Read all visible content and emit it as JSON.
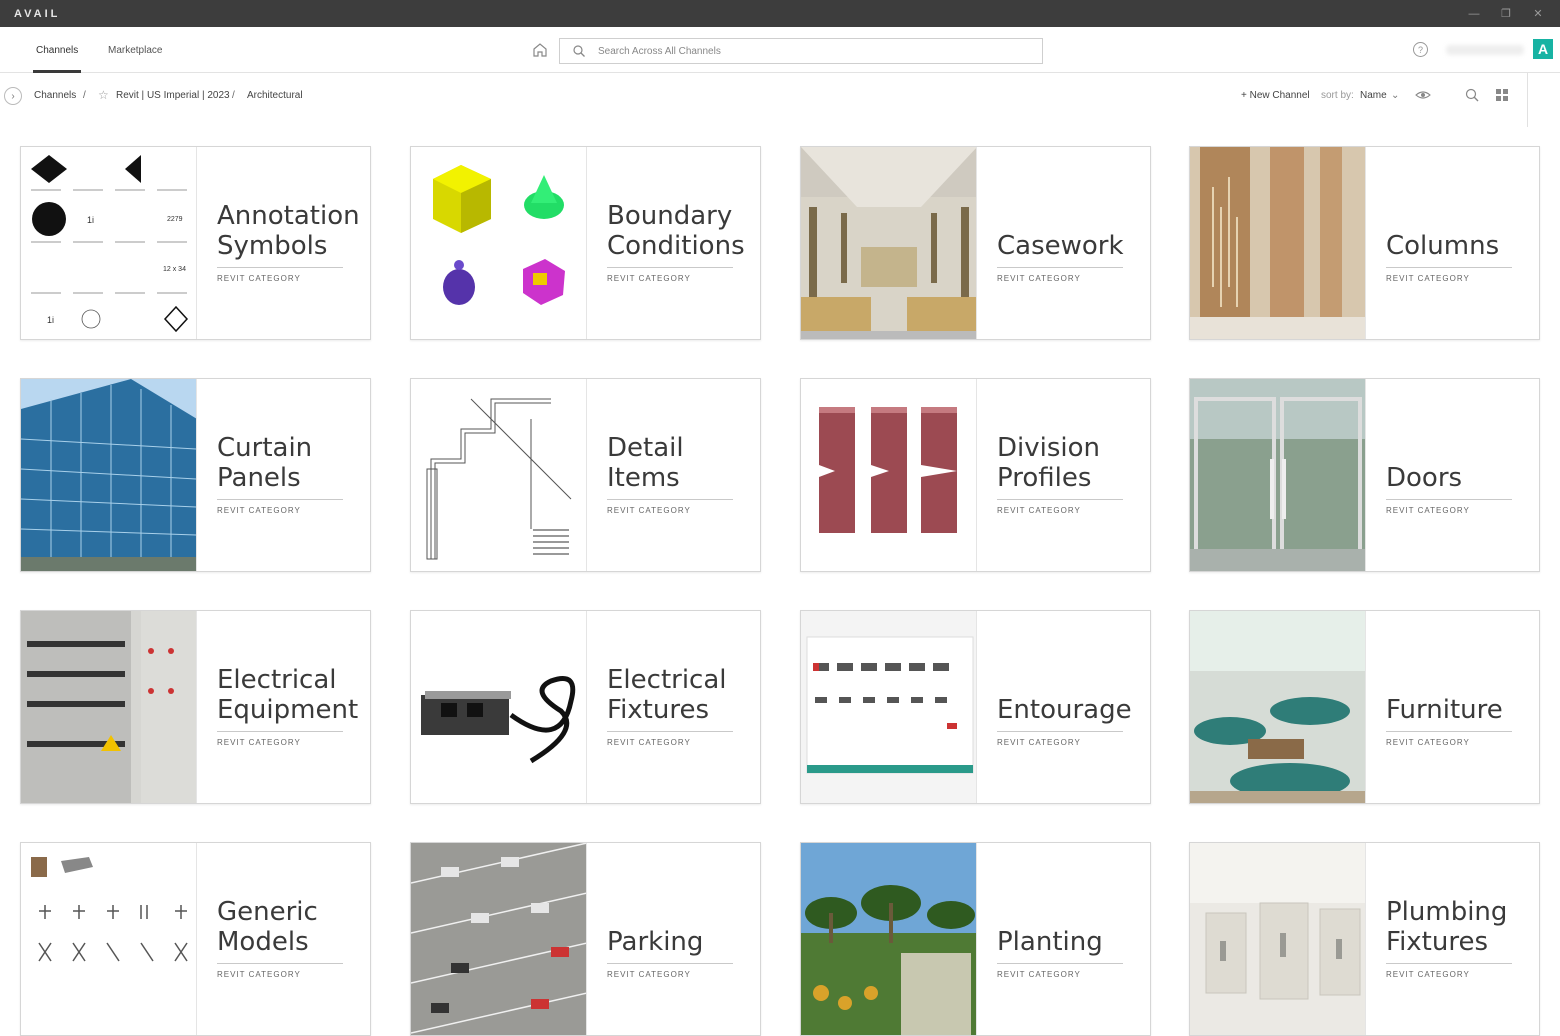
{
  "app": {
    "title": "AVAIL"
  },
  "window_controls": [
    "—",
    "❐",
    "✕"
  ],
  "nav": {
    "tabs": [
      {
        "label": "Channels",
        "active": true
      },
      {
        "label": "Marketplace",
        "active": false
      }
    ],
    "search_placeholder": "Search Across All Channels",
    "help_glyph": "?",
    "logo_letter": "A"
  },
  "breadcrumb": {
    "items": [
      "Channels",
      "Revit | US Imperial | 2023",
      "Architectural"
    ],
    "separator": "/"
  },
  "toolbar": {
    "new_channel": "+ New Channel",
    "sort_label": "sort by:",
    "sort_value": "Name"
  },
  "cards": [
    {
      "title1": "Annotation",
      "title2": "Symbols",
      "subtitle": "REVIT CATEGORY",
      "thumb": "annotation"
    },
    {
      "title1": "Boundary",
      "title2": "Conditions",
      "subtitle": "REVIT CATEGORY",
      "thumb": "boundary"
    },
    {
      "title1": "Casework",
      "title2": "",
      "subtitle": "REVIT CATEGORY",
      "thumb": "casework"
    },
    {
      "title1": "Columns",
      "title2": "",
      "subtitle": "REVIT CATEGORY",
      "thumb": "columns"
    },
    {
      "title1": "Curtain",
      "title2": "Panels",
      "subtitle": "REVIT CATEGORY",
      "thumb": "curtain"
    },
    {
      "title1": "Detail",
      "title2": "Items",
      "subtitle": "REVIT CATEGORY",
      "thumb": "detail"
    },
    {
      "title1": "Division",
      "title2": "Profiles",
      "subtitle": "REVIT CATEGORY",
      "thumb": "division"
    },
    {
      "title1": "Doors",
      "title2": "",
      "subtitle": "REVIT CATEGORY",
      "thumb": "doors"
    },
    {
      "title1": "Electrical",
      "title2": "Equipment",
      "subtitle": "REVIT CATEGORY",
      "thumb": "elecequip"
    },
    {
      "title1": "Electrical",
      "title2": "Fixtures",
      "subtitle": "REVIT CATEGORY",
      "thumb": "elecfix"
    },
    {
      "title1": "Entourage",
      "title2": "",
      "subtitle": "REVIT CATEGORY",
      "thumb": "entourage"
    },
    {
      "title1": "Furniture",
      "title2": "",
      "subtitle": "REVIT CATEGORY",
      "thumb": "furniture"
    },
    {
      "title1": "Generic",
      "title2": "Models",
      "subtitle": "REVIT CATEGORY",
      "thumb": "generic"
    },
    {
      "title1": "Parking",
      "title2": "",
      "subtitle": "REVIT CATEGORY",
      "thumb": "parking"
    },
    {
      "title1": "Planting",
      "title2": "",
      "subtitle": "REVIT CATEGORY",
      "thumb": "planting"
    },
    {
      "title1": "Plumbing",
      "title2": "Fixtures",
      "subtitle": "REVIT CATEGORY",
      "thumb": "plumbing"
    }
  ],
  "colors": {
    "titlebar": "#3d3d3d",
    "accent": "#17b3a3",
    "active_tab": "#3a3a3a"
  }
}
